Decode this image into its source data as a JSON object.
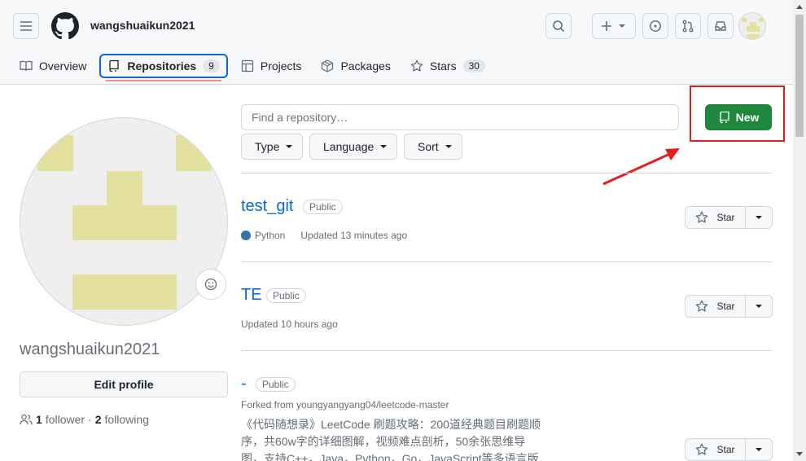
{
  "header": {
    "username": "wangshuaikun2021"
  },
  "tabs": [
    {
      "label": "Overview",
      "icon": "book-icon"
    },
    {
      "label": "Repositories",
      "icon": "repo-icon",
      "count": "9"
    },
    {
      "label": "Projects",
      "icon": "table-icon"
    },
    {
      "label": "Packages",
      "icon": "package-icon"
    },
    {
      "label": "Stars",
      "icon": "star-icon",
      "count": "30"
    }
  ],
  "profile": {
    "name": "wangshuaikun2021",
    "edit_label": "Edit profile",
    "followers": "1",
    "followers_label": "follower",
    "separator": "·",
    "following": "2",
    "following_label": "following"
  },
  "toolbar": {
    "search_placeholder": "Find a repository…",
    "type_label": "Type",
    "language_label": "Language",
    "sort_label": "Sort",
    "new_label": "New"
  },
  "repos": [
    {
      "name": "test_git",
      "visibility": "Public",
      "language": "Python",
      "updated": "Updated 13 minutes ago",
      "star_label": "Star"
    },
    {
      "name": "TE",
      "visibility": "Public",
      "updated": "Updated 10 hours ago",
      "star_label": "Star"
    },
    {
      "name": "-",
      "visibility": "Public",
      "forked_from": "Forked from youngyangyang04/leetcode-master",
      "description": "《代码随想录》LeetCode 刷题攻略：200道经典题目刷题顺序，共60w字的详细图解，视频难点剖析，50余张思维导图，支持C++，Java，Python，Go，JavaScript等多语言版",
      "star_label": "Star"
    }
  ],
  "colors": {
    "accent": "#0969da",
    "new_button": "#1f883d",
    "annotation": "#e02020",
    "python": "#3572a5",
    "avatar": "#e4e0a0"
  }
}
